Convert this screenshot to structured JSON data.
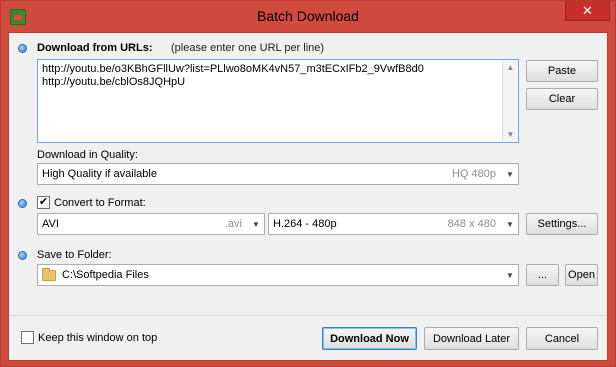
{
  "window": {
    "title": "Batch Download",
    "close_glyph": "✕"
  },
  "urls": {
    "label": "Download from URLs:",
    "hint": "(please enter one URL per line)",
    "lines": [
      "http://youtu.be/o3KBhGFllUw?list=PLlwo8oMK4vN57_m3tECxIFb2_9VwfB8d0",
      "http://youtu.be/cblOs8JQHpU"
    ],
    "paste_label": "Paste",
    "clear_label": "Clear"
  },
  "quality": {
    "label": "Download in Quality:",
    "value": "High Quality if available",
    "sub": "HQ 480p"
  },
  "convert": {
    "label": "Convert to Format:",
    "checked": true,
    "format": {
      "value": "AVI",
      "sub": ".avi"
    },
    "codec": {
      "value": "H.264 - 480p",
      "sub": "848 x 480"
    },
    "settings_label": "Settings..."
  },
  "folder": {
    "label": "Save to Folder:",
    "value": "C:\\Softpedia Files",
    "browse_label": "...",
    "open_label": "Open"
  },
  "footer": {
    "keep_on_top_label": "Keep this window on top",
    "download_now_label": "Download Now",
    "download_later_label": "Download Later",
    "cancel_label": "Cancel"
  },
  "icons": {
    "app": "app-icon",
    "checkbox_mark": "✔",
    "dropdown": "▼",
    "scroll_up": "▲",
    "scroll_down": "▼"
  },
  "colors": {
    "titlebar": "#d04a3e",
    "close_button": "#c7302a",
    "accent_dot": "#2d7fd3",
    "field_border": "#7aa7d8",
    "primary_button_border": "#3c7fb1"
  }
}
